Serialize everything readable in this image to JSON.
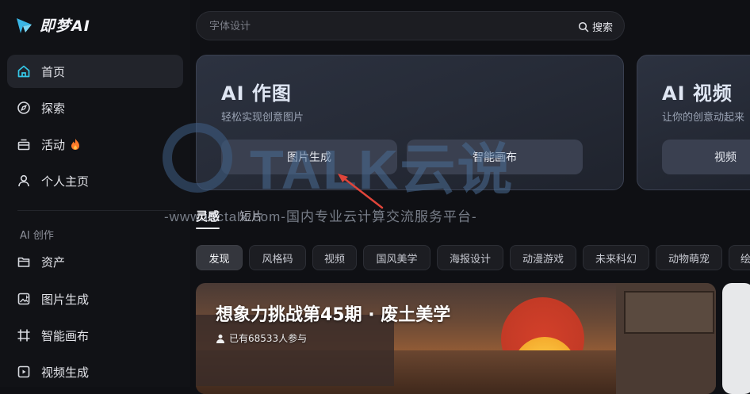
{
  "app": {
    "name": "即梦AI"
  },
  "sidebar": {
    "items": [
      {
        "label": "首页",
        "icon": "home-icon",
        "active": true
      },
      {
        "label": "探索",
        "icon": "compass-icon"
      },
      {
        "label": "活动",
        "icon": "gift-icon",
        "badge_icon": "fire-icon"
      },
      {
        "label": "个人主页",
        "icon": "user-icon"
      }
    ],
    "section_title": "AI 创作",
    "create_items": [
      {
        "label": "资产",
        "icon": "folder-icon"
      },
      {
        "label": "图片生成",
        "icon": "image-generate-icon"
      },
      {
        "label": "智能画布",
        "icon": "canvas-icon"
      },
      {
        "label": "视频生成",
        "icon": "video-generate-icon"
      }
    ]
  },
  "search": {
    "placeholder": "字体设计",
    "button_label": "搜索"
  },
  "hero_cards": [
    {
      "title": "AI 作图",
      "subtitle": "轻松实现创意图片",
      "buttons": [
        "图片生成",
        "智能画布"
      ]
    },
    {
      "title": "AI 视频",
      "subtitle": "让你的创意动起来",
      "buttons": [
        "视频"
      ]
    }
  ],
  "tabs": [
    {
      "label": "灵感",
      "active": true
    },
    {
      "label": "短片"
    }
  ],
  "chips": [
    "发现",
    "风格码",
    "视频",
    "国风美学",
    "海报设计",
    "动漫游戏",
    "未来科幻",
    "动物萌宠",
    "绘"
  ],
  "banner": {
    "title": "想象力挑战第45期 · 废土美学",
    "participants": "已有68533人参与"
  },
  "watermark": {
    "brand": "TALK云说",
    "url": "-www.idctalk.com-国内专业云计算交流服务平台-"
  },
  "colors": {
    "accent": "#2ec5e8",
    "fire": "#ff7a2a",
    "arrow": "#e0453a"
  }
}
